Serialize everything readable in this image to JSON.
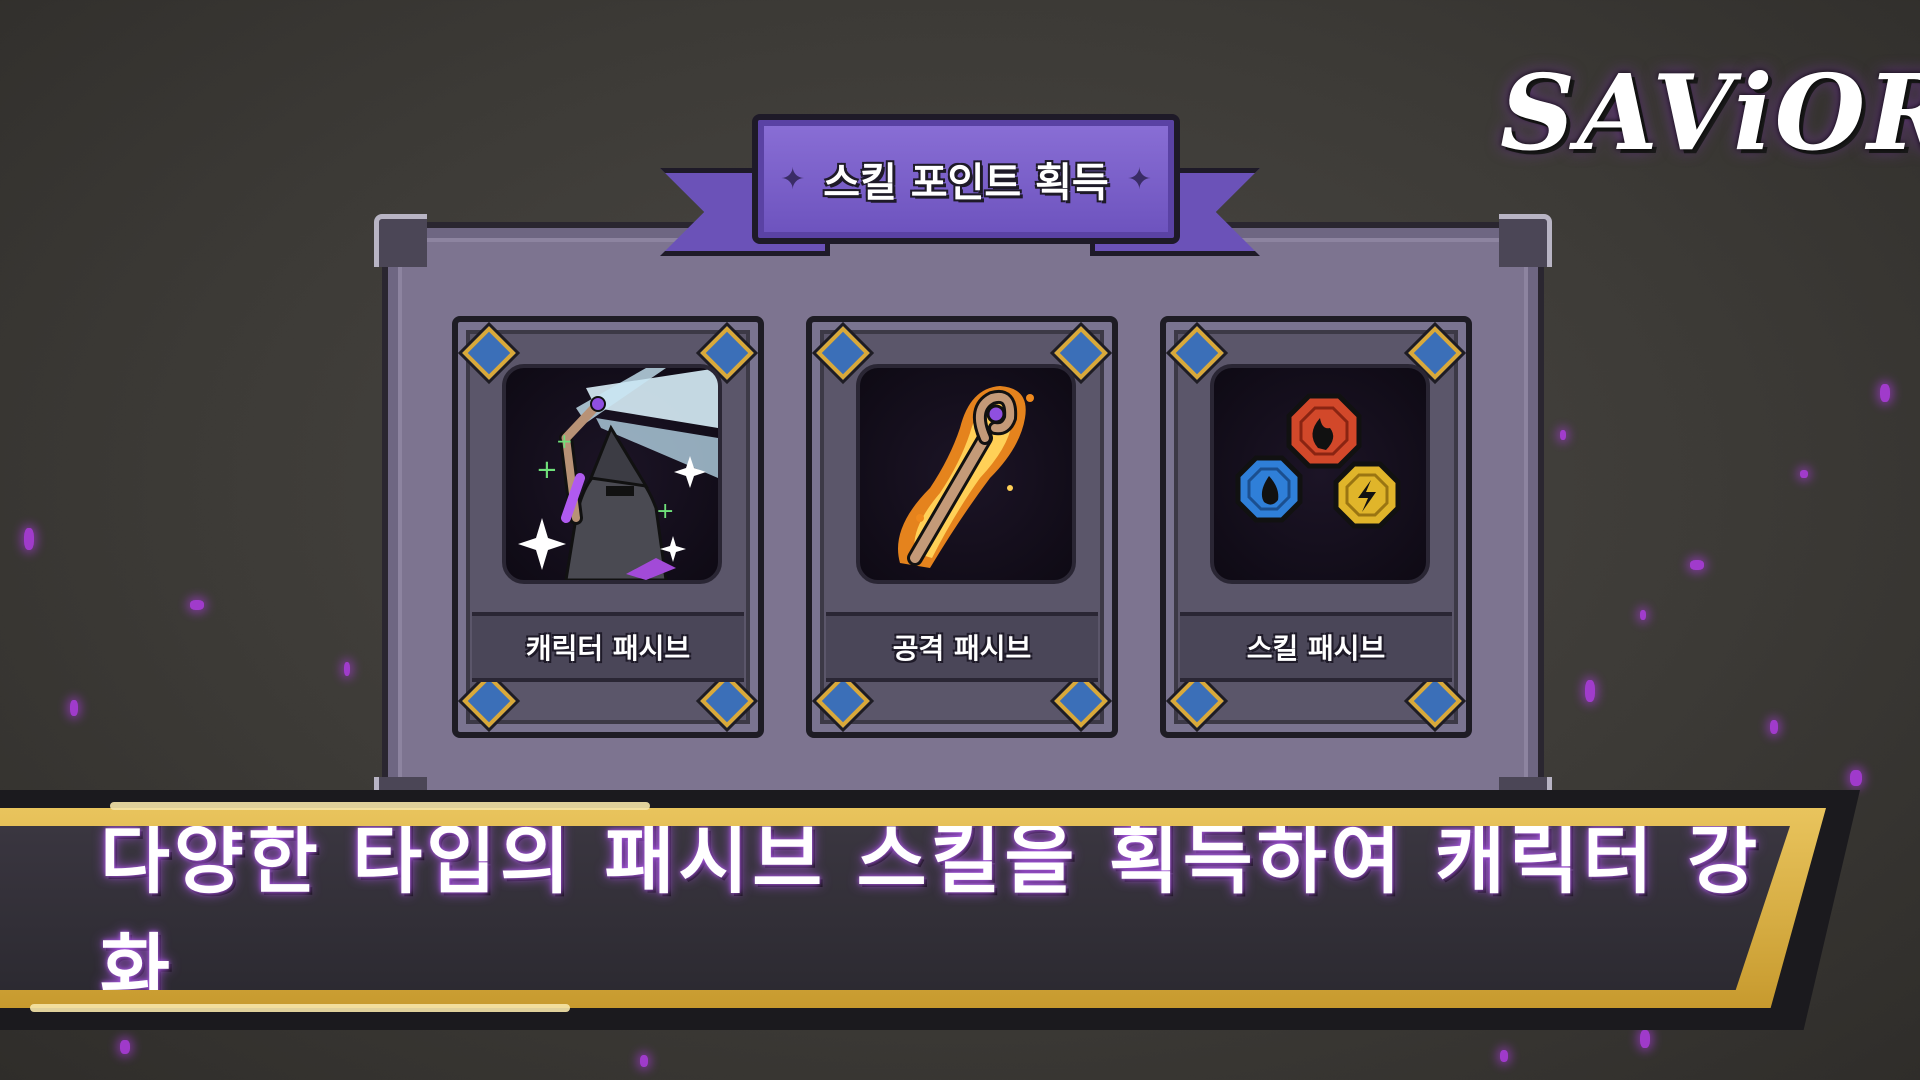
{
  "logo": {
    "text": "SAViOR"
  },
  "ribbon": {
    "title": "스킬 포인트 획득",
    "star_icon": "sparkle-icon"
  },
  "cards": [
    {
      "label": "캐릭터 패시브",
      "icon": "wizard-casting-icon"
    },
    {
      "label": "공격 패시브",
      "icon": "flaming-staff-icon"
    },
    {
      "label": "스킬 패시브",
      "icon": "elemental-orbs-icon"
    }
  ],
  "banner": {
    "text": "다양한 타입의 패시브 스킬을 획득하여 캐릭터 강화"
  },
  "colors": {
    "background": "#3d3b37",
    "panel": "#7d7490",
    "ribbon": "#6c52bd",
    "gold": "#d9a93a",
    "particle": "#b23ce6",
    "fire": "#d2482a",
    "water": "#2f7fd8",
    "lightning": "#e0b52a"
  }
}
